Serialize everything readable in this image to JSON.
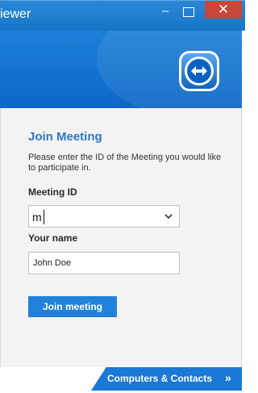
{
  "window": {
    "title": "iewer"
  },
  "controls": {
    "minimize": "–",
    "close": "✕"
  },
  "main": {
    "heading": "Join Meeting",
    "description": "Please enter the ID of the Meeting you would like to participate in.",
    "meeting_id_label": "Meeting ID",
    "meeting_id_value": "m",
    "name_label": "Your name",
    "name_value": "John Doe",
    "join_button_label": "Join meeting"
  },
  "footer": {
    "tab_label": "Computers & Contacts",
    "arrow": "»"
  },
  "icons": {
    "logo": "teamviewer-logo-icon",
    "dropdown": "chevron-down-icon"
  },
  "colors": {
    "titlebar": "#1775c7",
    "banner": "#0b67c8",
    "accent": "#2282db",
    "close": "#c9463d"
  }
}
